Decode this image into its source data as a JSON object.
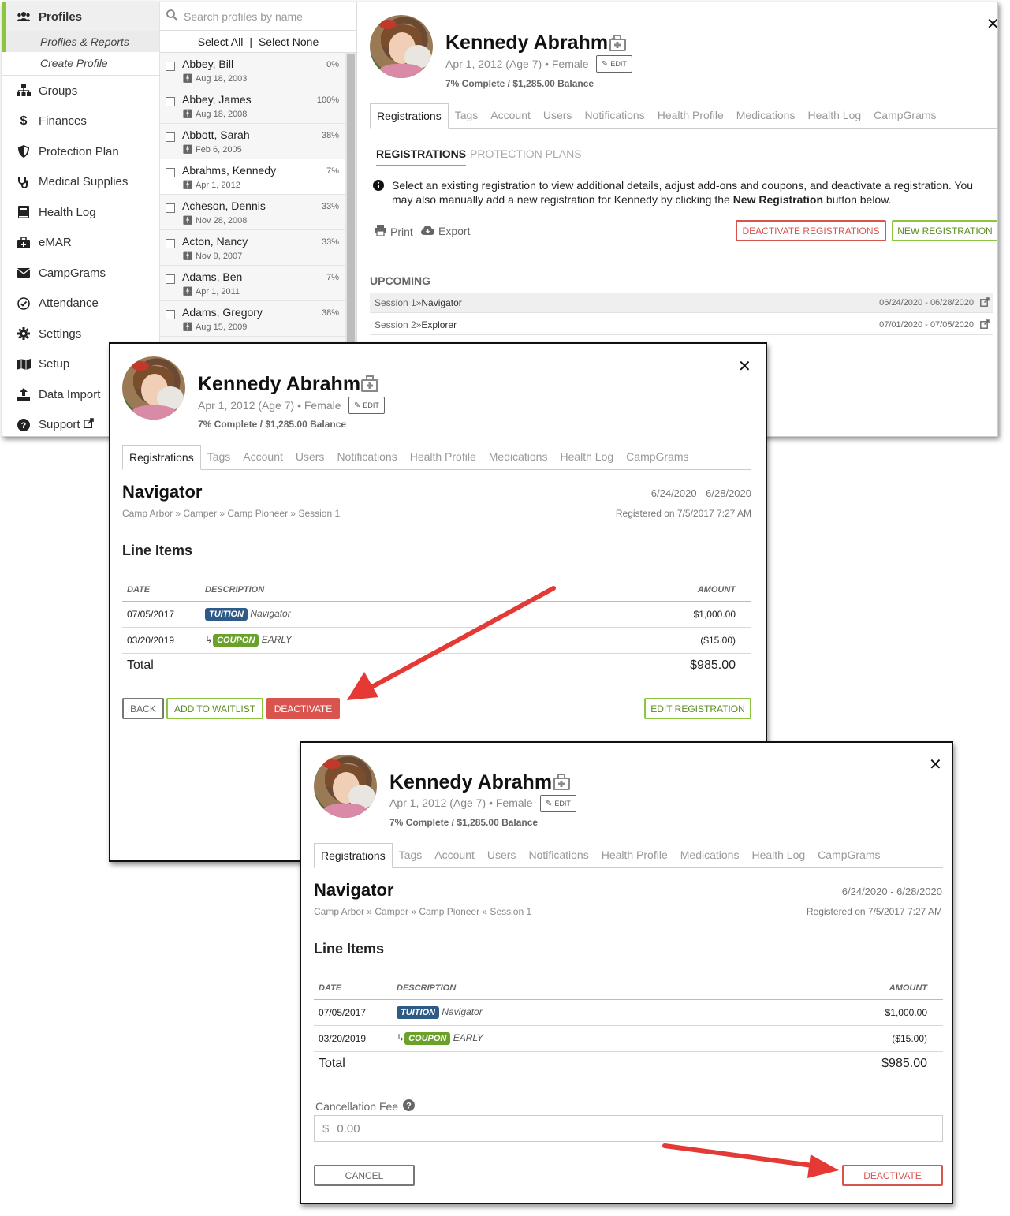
{
  "sidebar": {
    "header": "Profiles",
    "subitems": [
      "Profiles & Reports",
      "Create Profile"
    ],
    "items": [
      {
        "label": "Groups",
        "icon": "sitemap-icon"
      },
      {
        "label": "Finances",
        "icon": "dollar-icon"
      },
      {
        "label": "Protection Plan",
        "icon": "shield-icon"
      },
      {
        "label": "Medical Supplies",
        "icon": "stethoscope-icon"
      },
      {
        "label": "Health Log",
        "icon": "book-icon"
      },
      {
        "label": "eMAR",
        "icon": "medkit-icon"
      },
      {
        "label": "CampGrams",
        "icon": "envelope-icon"
      },
      {
        "label": "Attendance",
        "icon": "check-circle-icon"
      },
      {
        "label": "Settings",
        "icon": "gear-icon"
      },
      {
        "label": "Setup",
        "icon": "map-icon"
      },
      {
        "label": "Data Import",
        "icon": "upload-icon"
      },
      {
        "label": "Support",
        "icon": "question-circle-icon"
      }
    ]
  },
  "profile_list": {
    "search_placeholder": "Search profiles by name",
    "select_all": "Select All",
    "separator": "|",
    "select_none": "Select None",
    "rows": [
      {
        "name": "Abbey, Bill",
        "date": "Aug 18, 2003",
        "pct": "0%"
      },
      {
        "name": "Abbey, James",
        "date": "Aug 18, 2008",
        "pct": "100%"
      },
      {
        "name": "Abbott, Sarah",
        "date": "Feb 6, 2005",
        "pct": "38%"
      },
      {
        "name": "Abrahms, Kennedy",
        "date": "Apr 1, 2012",
        "pct": "7%"
      },
      {
        "name": "Acheson, Dennis",
        "date": "Nov 28, 2008",
        "pct": "33%"
      },
      {
        "name": "Acton, Nancy",
        "date": "Nov 9, 2007",
        "pct": "33%"
      },
      {
        "name": "Adams, Ben",
        "date": "Apr 1, 2011",
        "pct": "7%"
      },
      {
        "name": "Adams, Gregory",
        "date": "Aug 15, 2009",
        "pct": "38%"
      }
    ]
  },
  "profile": {
    "name": "Kennedy Abrahms",
    "meta": "Apr 1, 2012 (Age 7) • Female",
    "edit": "EDIT",
    "balance": "7% Complete / $1,285.00 Balance"
  },
  "tabs1": [
    "Registrations",
    "Tags",
    "Account",
    "Users",
    "Notifications",
    "Health Profile",
    "Medications",
    "Health Log",
    "CampGrams"
  ],
  "tabs2": [
    "Registrations",
    "Tags",
    "Account",
    "Users",
    "Notifications",
    "Health Profile",
    "Medications",
    "Health Log",
    "CampGrams"
  ],
  "registrations": {
    "subtab_active": "REGISTRATIONS",
    "subtab_other": "PROTECTION PLANS",
    "info_pre": "Select an existing registration to view additional details, adjust add-ons and coupons, and deactivate a registration. You may also manually add a new registration for Kennedy by clicking the ",
    "info_bold": "New Registration",
    "info_post": " button below.",
    "print": "Print",
    "export": "Export",
    "deactivate_registrations": "DEACTIVATE REGISTRATIONS",
    "new_registration": "NEW REGISTRATION",
    "upcoming": "UPCOMING",
    "sessions": [
      {
        "session": "Session 1",
        "sep": " » ",
        "program": "Navigator",
        "dates": "06/24/2020 - 06/28/2020"
      },
      {
        "session": "Session 2",
        "sep": " » ",
        "program": "Explorer",
        "dates": "07/01/2020 - 07/05/2020"
      }
    ]
  },
  "registration_detail": {
    "title": "Navigator",
    "breadcrumb": "Camp Arbor » Camper » Camp Pioneer » Session 1",
    "dates": "6/24/2020 - 6/28/2020",
    "registered_on": "Registered on 7/5/2017 7:27 AM",
    "line_items_heading": "Line Items",
    "columns": {
      "date": "DATE",
      "description": "DESCRIPTION",
      "amount": "AMOUNT"
    },
    "items": [
      {
        "date": "07/05/2017",
        "badge": "TUITION",
        "desc": "Navigator",
        "amount": "$1,000.00"
      },
      {
        "date": "03/20/2019",
        "prefix": "↳",
        "badge": "COUPON",
        "desc": "EARLY",
        "amount": "($15.00)"
      }
    ],
    "total_label": "Total",
    "total_amount": "$985.00",
    "back": "BACK",
    "add_to_waitlist": "ADD TO WAITLIST",
    "deactivate": "DEACTIVATE",
    "edit_registration": "EDIT REGISTRATION"
  },
  "deactivate_form": {
    "fee_label": "Cancellation Fee",
    "currency": "$",
    "fee_value": "0.00",
    "cancel": "CANCEL",
    "deactivate": "DEACTIVATE"
  },
  "colors": {
    "accent_green": "#8cc63f",
    "danger_red": "#d9534f",
    "arrow_red": "#e53935",
    "tuition_blue": "#2e5a87",
    "coupon_green": "#6aa12a"
  }
}
